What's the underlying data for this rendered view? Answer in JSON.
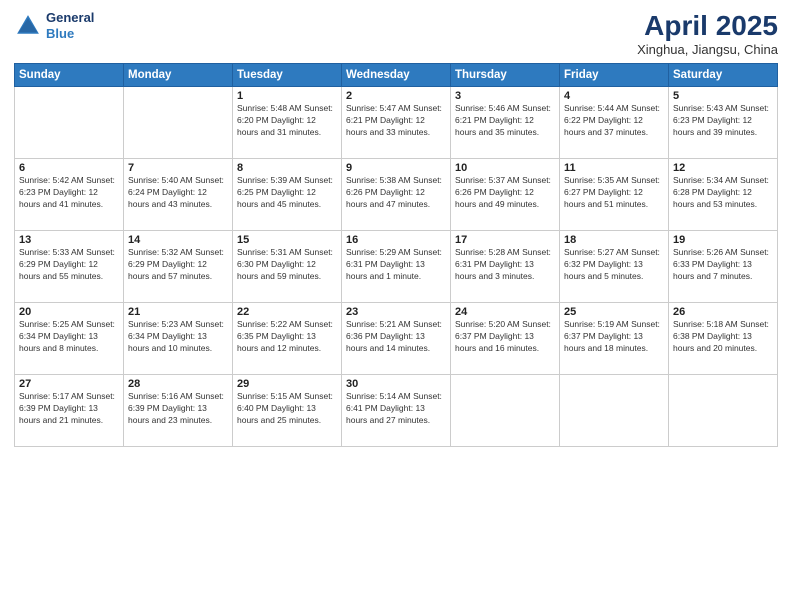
{
  "logo": {
    "line1": "General",
    "line2": "Blue"
  },
  "title": {
    "month": "April 2025",
    "location": "Xinghua, Jiangsu, China"
  },
  "days_of_week": [
    "Sunday",
    "Monday",
    "Tuesday",
    "Wednesday",
    "Thursday",
    "Friday",
    "Saturday"
  ],
  "weeks": [
    [
      {
        "day": "",
        "info": ""
      },
      {
        "day": "",
        "info": ""
      },
      {
        "day": "1",
        "info": "Sunrise: 5:48 AM\nSunset: 6:20 PM\nDaylight: 12 hours\nand 31 minutes."
      },
      {
        "day": "2",
        "info": "Sunrise: 5:47 AM\nSunset: 6:21 PM\nDaylight: 12 hours\nand 33 minutes."
      },
      {
        "day": "3",
        "info": "Sunrise: 5:46 AM\nSunset: 6:21 PM\nDaylight: 12 hours\nand 35 minutes."
      },
      {
        "day": "4",
        "info": "Sunrise: 5:44 AM\nSunset: 6:22 PM\nDaylight: 12 hours\nand 37 minutes."
      },
      {
        "day": "5",
        "info": "Sunrise: 5:43 AM\nSunset: 6:23 PM\nDaylight: 12 hours\nand 39 minutes."
      }
    ],
    [
      {
        "day": "6",
        "info": "Sunrise: 5:42 AM\nSunset: 6:23 PM\nDaylight: 12 hours\nand 41 minutes."
      },
      {
        "day": "7",
        "info": "Sunrise: 5:40 AM\nSunset: 6:24 PM\nDaylight: 12 hours\nand 43 minutes."
      },
      {
        "day": "8",
        "info": "Sunrise: 5:39 AM\nSunset: 6:25 PM\nDaylight: 12 hours\nand 45 minutes."
      },
      {
        "day": "9",
        "info": "Sunrise: 5:38 AM\nSunset: 6:26 PM\nDaylight: 12 hours\nand 47 minutes."
      },
      {
        "day": "10",
        "info": "Sunrise: 5:37 AM\nSunset: 6:26 PM\nDaylight: 12 hours\nand 49 minutes."
      },
      {
        "day": "11",
        "info": "Sunrise: 5:35 AM\nSunset: 6:27 PM\nDaylight: 12 hours\nand 51 minutes."
      },
      {
        "day": "12",
        "info": "Sunrise: 5:34 AM\nSunset: 6:28 PM\nDaylight: 12 hours\nand 53 minutes."
      }
    ],
    [
      {
        "day": "13",
        "info": "Sunrise: 5:33 AM\nSunset: 6:29 PM\nDaylight: 12 hours\nand 55 minutes."
      },
      {
        "day": "14",
        "info": "Sunrise: 5:32 AM\nSunset: 6:29 PM\nDaylight: 12 hours\nand 57 minutes."
      },
      {
        "day": "15",
        "info": "Sunrise: 5:31 AM\nSunset: 6:30 PM\nDaylight: 12 hours\nand 59 minutes."
      },
      {
        "day": "16",
        "info": "Sunrise: 5:29 AM\nSunset: 6:31 PM\nDaylight: 13 hours\nand 1 minute."
      },
      {
        "day": "17",
        "info": "Sunrise: 5:28 AM\nSunset: 6:31 PM\nDaylight: 13 hours\nand 3 minutes."
      },
      {
        "day": "18",
        "info": "Sunrise: 5:27 AM\nSunset: 6:32 PM\nDaylight: 13 hours\nand 5 minutes."
      },
      {
        "day": "19",
        "info": "Sunrise: 5:26 AM\nSunset: 6:33 PM\nDaylight: 13 hours\nand 7 minutes."
      }
    ],
    [
      {
        "day": "20",
        "info": "Sunrise: 5:25 AM\nSunset: 6:34 PM\nDaylight: 13 hours\nand 8 minutes."
      },
      {
        "day": "21",
        "info": "Sunrise: 5:23 AM\nSunset: 6:34 PM\nDaylight: 13 hours\nand 10 minutes."
      },
      {
        "day": "22",
        "info": "Sunrise: 5:22 AM\nSunset: 6:35 PM\nDaylight: 13 hours\nand 12 minutes."
      },
      {
        "day": "23",
        "info": "Sunrise: 5:21 AM\nSunset: 6:36 PM\nDaylight: 13 hours\nand 14 minutes."
      },
      {
        "day": "24",
        "info": "Sunrise: 5:20 AM\nSunset: 6:37 PM\nDaylight: 13 hours\nand 16 minutes."
      },
      {
        "day": "25",
        "info": "Sunrise: 5:19 AM\nSunset: 6:37 PM\nDaylight: 13 hours\nand 18 minutes."
      },
      {
        "day": "26",
        "info": "Sunrise: 5:18 AM\nSunset: 6:38 PM\nDaylight: 13 hours\nand 20 minutes."
      }
    ],
    [
      {
        "day": "27",
        "info": "Sunrise: 5:17 AM\nSunset: 6:39 PM\nDaylight: 13 hours\nand 21 minutes."
      },
      {
        "day": "28",
        "info": "Sunrise: 5:16 AM\nSunset: 6:39 PM\nDaylight: 13 hours\nand 23 minutes."
      },
      {
        "day": "29",
        "info": "Sunrise: 5:15 AM\nSunset: 6:40 PM\nDaylight: 13 hours\nand 25 minutes."
      },
      {
        "day": "30",
        "info": "Sunrise: 5:14 AM\nSunset: 6:41 PM\nDaylight: 13 hours\nand 27 minutes."
      },
      {
        "day": "",
        "info": ""
      },
      {
        "day": "",
        "info": ""
      },
      {
        "day": "",
        "info": ""
      }
    ]
  ]
}
